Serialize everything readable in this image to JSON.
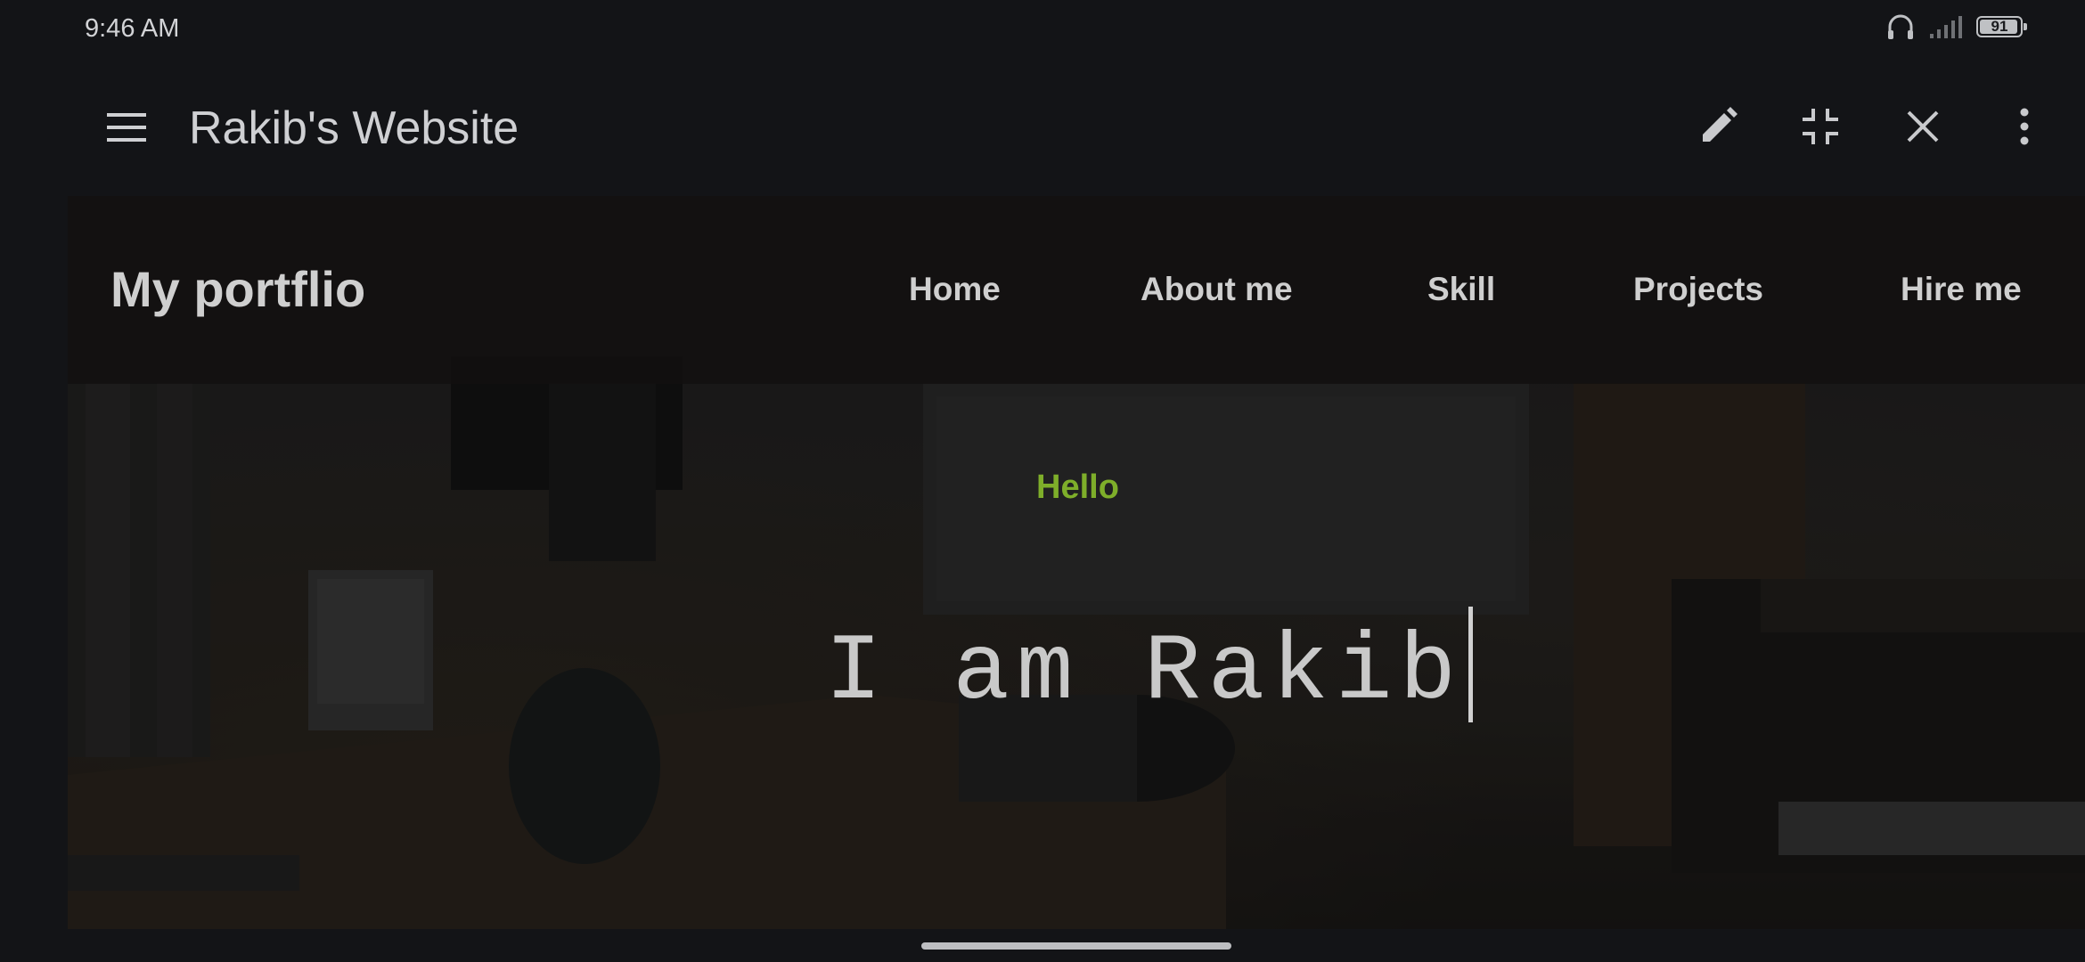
{
  "status_bar": {
    "time": "9:46 AM",
    "battery_level": "91",
    "icons": [
      "headphones-icon",
      "signal-icon",
      "battery-icon"
    ]
  },
  "app_bar": {
    "title": "Rakib's Website",
    "icons": [
      "menu-icon",
      "edit-icon",
      "exit-fullscreen-icon",
      "close-icon",
      "more-vert-icon"
    ]
  },
  "site": {
    "brand": "My portflio",
    "nav": [
      "Home",
      "About me",
      "Skill",
      "Projects",
      "Hire me"
    ],
    "hero": {
      "greeting": "Hello",
      "headline": "I am Rakib"
    },
    "colors": {
      "greeting": "#7eae2a",
      "nav_text": "#cfcfcf"
    }
  }
}
